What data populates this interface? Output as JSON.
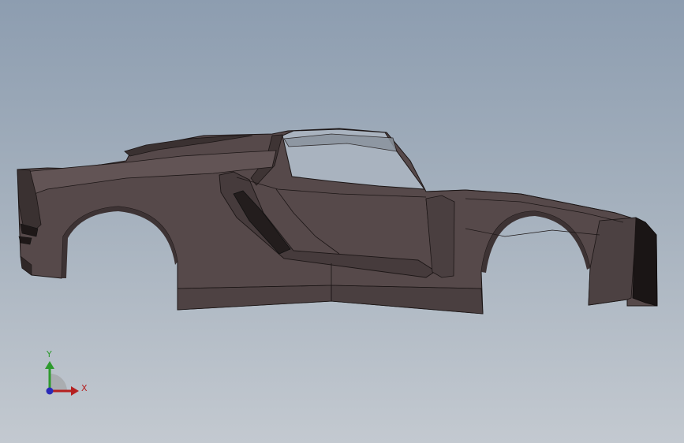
{
  "viewport": {
    "background_top": "#8d9db0",
    "background_bottom": "#c3c9d0"
  },
  "model": {
    "body_color": "#56494a",
    "body_dark": "#2f2727",
    "edge_color": "#1c1616",
    "glass_color": "#a9b3bf"
  },
  "triad": {
    "y_label": "Y",
    "x_label": "X",
    "y_color": "#2e9a2e",
    "x_color": "#b52020",
    "z_color": "#2a2ab8"
  }
}
